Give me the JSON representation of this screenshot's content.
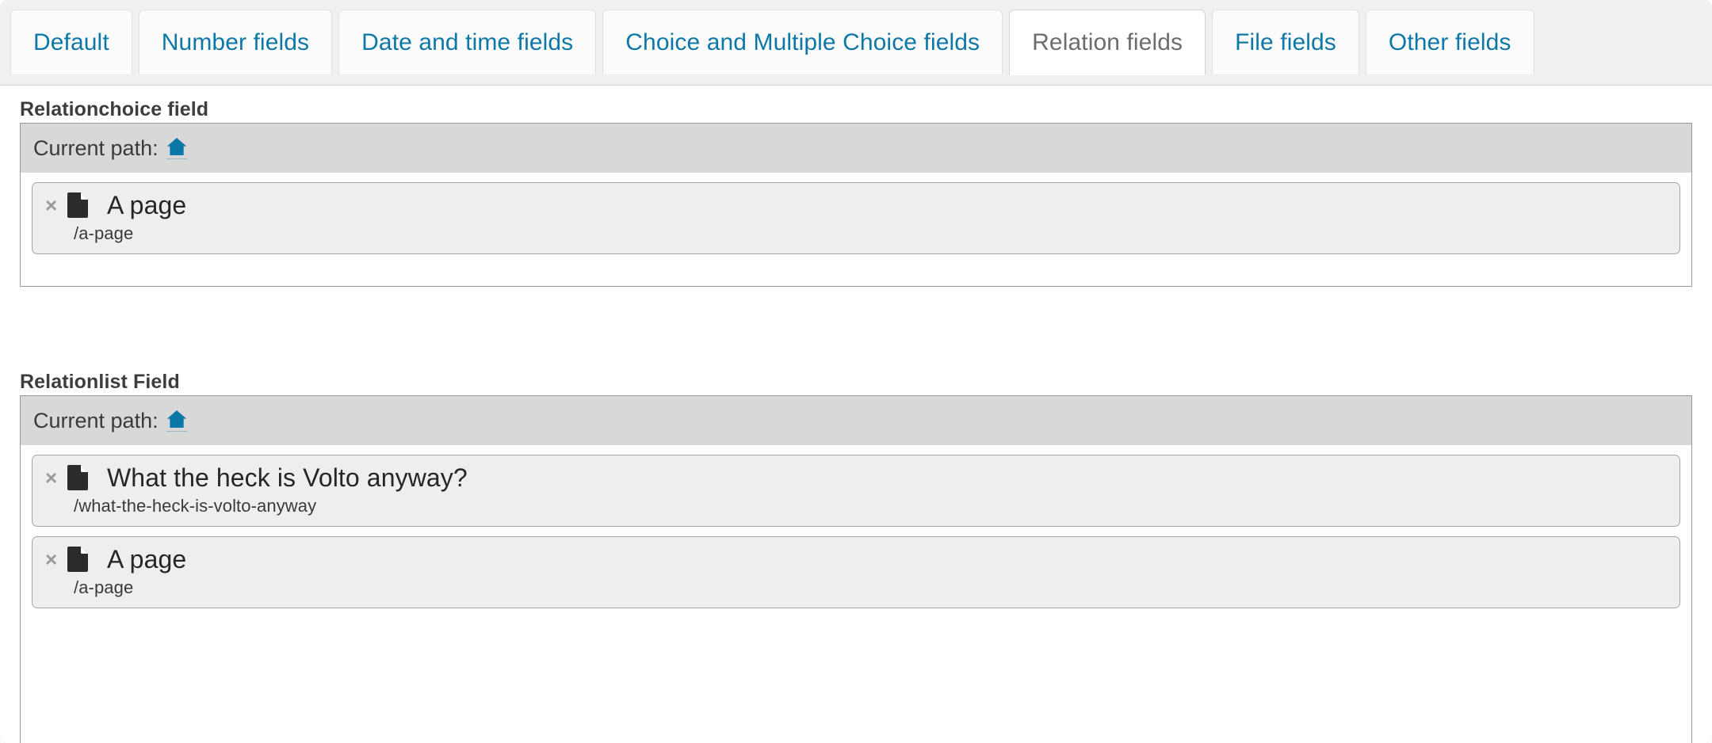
{
  "tabs": [
    {
      "label": "Default",
      "active": false
    },
    {
      "label": "Number fields",
      "active": false
    },
    {
      "label": "Date and time fields",
      "active": false
    },
    {
      "label": "Choice and Multiple Choice fields",
      "active": false
    },
    {
      "label": "Relation fields",
      "active": true
    },
    {
      "label": "File fields",
      "active": false
    },
    {
      "label": "Other fields",
      "active": false
    }
  ],
  "colors": {
    "tab_link": "#0d78a8",
    "tab_active_text": "#6c6c6c",
    "home_icon": "#0b77a8",
    "card_bg": "#eeeeee",
    "head_bg": "#d8d8d8"
  },
  "fields": [
    {
      "label": "Relationchoice field",
      "current_path_label": "Current path:",
      "home_icon": "home-icon",
      "items": [
        {
          "remove_label": "×",
          "icon": "file-icon",
          "title": "A page",
          "path": "/a-page"
        }
      ]
    },
    {
      "label": "Relationlist Field",
      "current_path_label": "Current path:",
      "home_icon": "home-icon",
      "items": [
        {
          "remove_label": "×",
          "icon": "file-icon",
          "title": "What the heck is Volto anyway?",
          "path": "/what-the-heck-is-volto-anyway"
        },
        {
          "remove_label": "×",
          "icon": "file-icon",
          "title": "A page",
          "path": "/a-page"
        }
      ]
    }
  ]
}
